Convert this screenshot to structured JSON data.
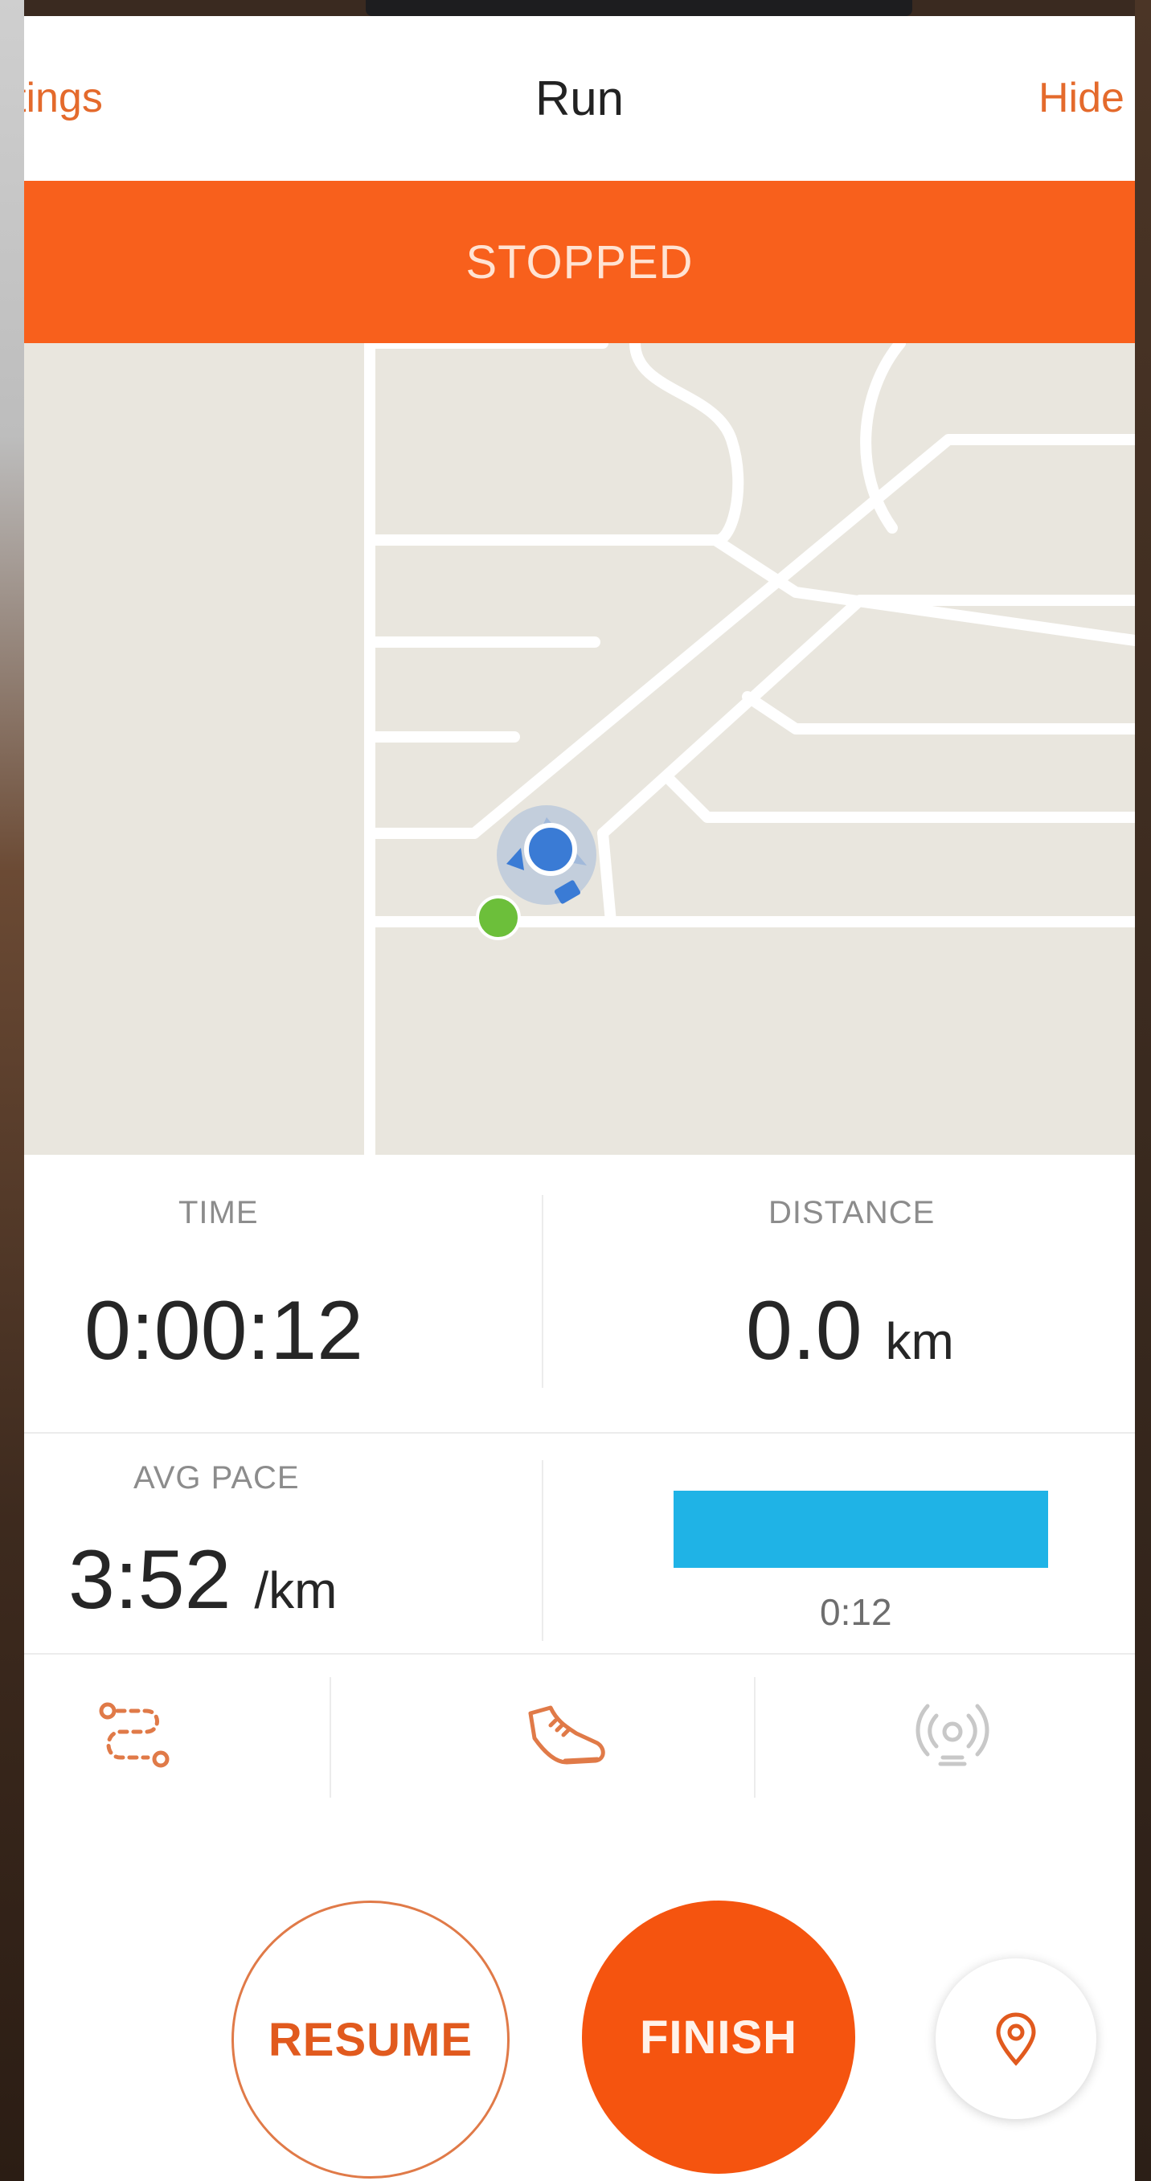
{
  "nav": {
    "left_label": "tings",
    "title": "Run",
    "right_label": "Hide"
  },
  "status": {
    "text": "STOPPED",
    "color": "#f8601c"
  },
  "stats": {
    "time": {
      "label": "TIME",
      "value": "0:00:12"
    },
    "distance": {
      "label": "DISTANCE",
      "value": "0.0",
      "unit": "km"
    },
    "avg_pace": {
      "label": "AVG PACE",
      "value": "3:52",
      "unit": "/km"
    },
    "split": {
      "time": "0:12",
      "bar_color": "#1fb3e6"
    }
  },
  "toolbar": {
    "items": [
      {
        "icon": "route-icon"
      },
      {
        "icon": "shoe-icon"
      },
      {
        "icon": "beacon-icon"
      }
    ]
  },
  "controls": {
    "resume_label": "RESUME",
    "finish_label": "FINISH",
    "locate_icon": "location-pin-icon"
  },
  "colors": {
    "accent": "#f5540f",
    "map_bg": "#e9e6de",
    "user_marker": "#3a7bd5",
    "start_marker": "#6cbf3a"
  }
}
